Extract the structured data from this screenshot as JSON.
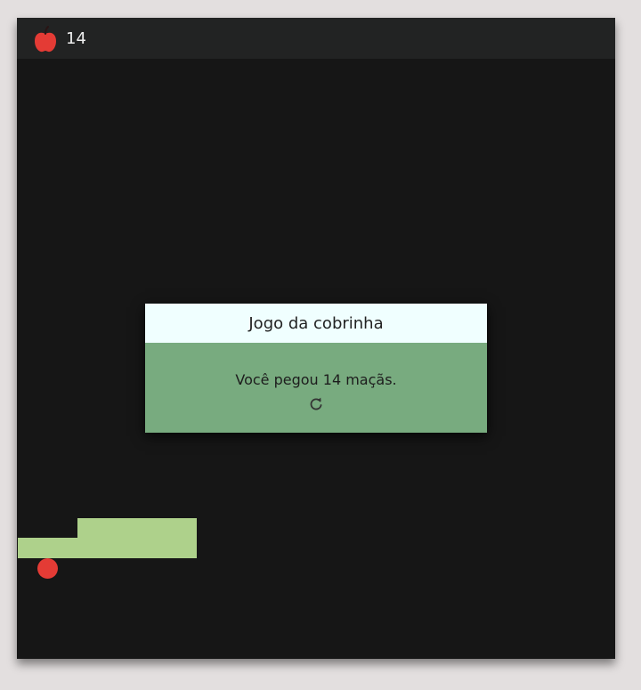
{
  "score": {
    "icon": "apple-icon",
    "value": "14"
  },
  "modal": {
    "title": "Jogo da cobrinha",
    "message": "Você pegou 14 maçãs.",
    "restart_icon": "restart-icon"
  },
  "board": {
    "snake_color": "#aed18b",
    "food_color": "#e43b35",
    "background_color": "#161616"
  }
}
